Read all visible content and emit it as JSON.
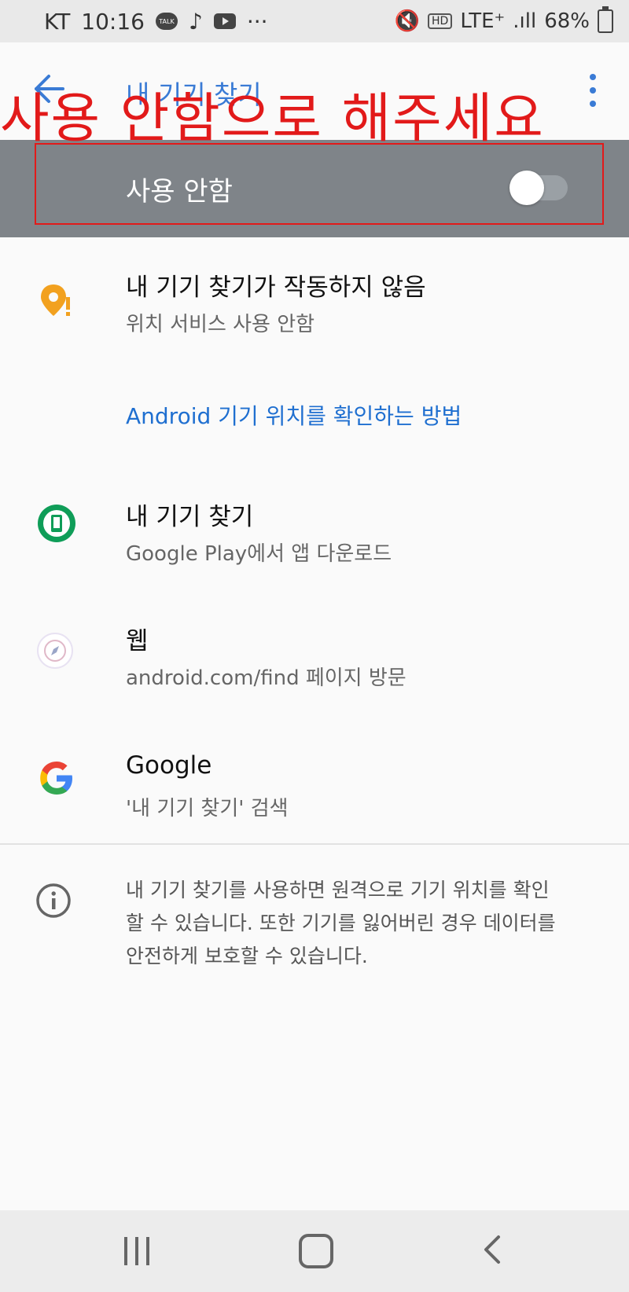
{
  "status_bar": {
    "carrier": "KT",
    "time": "10:16",
    "talk_label": "TALK",
    "more": "···",
    "hd": "HD",
    "network": "LTE⁺",
    "signal": ".ıll",
    "battery_percent": "68%"
  },
  "app_bar": {
    "title": "내 기기 찾기"
  },
  "annotation": {
    "text": "사용 안함으로 해주세요",
    "color": "#e21a1a"
  },
  "toggle": {
    "label": "사용 안함",
    "state": "off"
  },
  "items": [
    {
      "title": "내 기기 찾기가 작동하지 않음",
      "subtitle": "위치 서비스 사용 안함",
      "icon": "location-warning-icon"
    },
    {
      "title": "내 기기 찾기",
      "subtitle": "Google Play에서 앱 다운로드",
      "icon": "find-my-device-icon"
    },
    {
      "title": "웹",
      "subtitle": "android.com/find 페이지 방문",
      "icon": "compass-icon"
    },
    {
      "title": "Google",
      "subtitle": "'내 기기 찾기' 검색",
      "icon": "google-icon"
    }
  ],
  "link": {
    "text": "Android 기기 위치를 확인하는 방법"
  },
  "info": {
    "text": "내 기기 찾기를 사용하면 원격으로 기기 위치를 확인할 수 있습니다. 또한 기기를 잃어버린 경우 데이터를 안전하게 보호할 수 있습니다."
  },
  "colors": {
    "accent": "#3a7bd5",
    "link": "#1f6fd0",
    "toggle_bar": "#7f8489"
  }
}
